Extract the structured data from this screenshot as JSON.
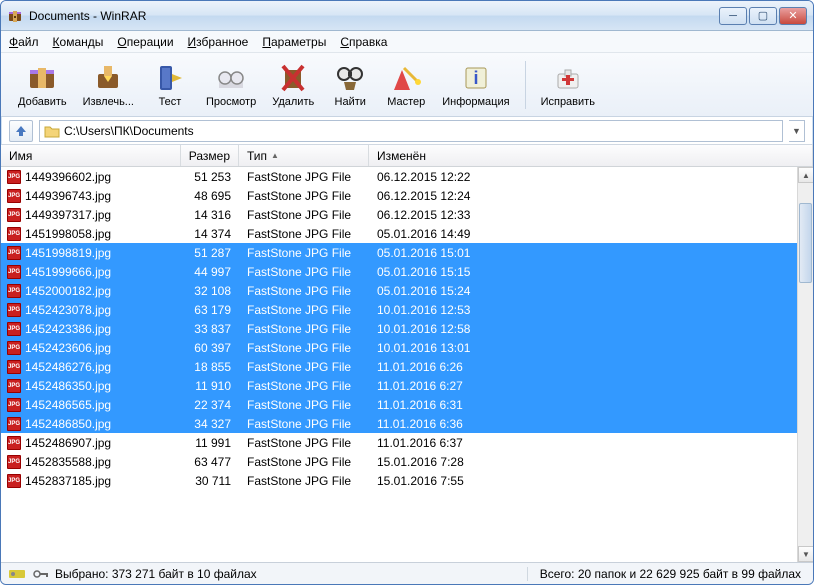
{
  "window": {
    "title": "Documents - WinRAR"
  },
  "menu": {
    "file": "Файл",
    "commands": "Команды",
    "operations": "Операции",
    "favorites": "Избранное",
    "options": "Параметры",
    "help": "Справка"
  },
  "toolbar": {
    "add": "Добавить",
    "extract": "Извлечь...",
    "test": "Тест",
    "view": "Просмотр",
    "delete": "Удалить",
    "find": "Найти",
    "wizard": "Мастер",
    "info": "Информация",
    "repair": "Исправить"
  },
  "path": "C:\\Users\\ПК\\Documents",
  "columns": {
    "name": "Имя",
    "size": "Размер",
    "type": "Тип",
    "modified": "Изменён"
  },
  "files": [
    {
      "name": "1449396602.jpg",
      "size": "51 253",
      "type": "FastStone JPG File",
      "mod": "06.12.2015 12:22",
      "sel": false
    },
    {
      "name": "1449396743.jpg",
      "size": "48 695",
      "type": "FastStone JPG File",
      "mod": "06.12.2015 12:24",
      "sel": false
    },
    {
      "name": "1449397317.jpg",
      "size": "14 316",
      "type": "FastStone JPG File",
      "mod": "06.12.2015 12:33",
      "sel": false
    },
    {
      "name": "1451998058.jpg",
      "size": "14 374",
      "type": "FastStone JPG File",
      "mod": "05.01.2016 14:49",
      "sel": false
    },
    {
      "name": "1451998819.jpg",
      "size": "51 287",
      "type": "FastStone JPG File",
      "mod": "05.01.2016 15:01",
      "sel": true
    },
    {
      "name": "1451999666.jpg",
      "size": "44 997",
      "type": "FastStone JPG File",
      "mod": "05.01.2016 15:15",
      "sel": true
    },
    {
      "name": "1452000182.jpg",
      "size": "32 108",
      "type": "FastStone JPG File",
      "mod": "05.01.2016 15:24",
      "sel": true
    },
    {
      "name": "1452423078.jpg",
      "size": "63 179",
      "type": "FastStone JPG File",
      "mod": "10.01.2016 12:53",
      "sel": true
    },
    {
      "name": "1452423386.jpg",
      "size": "33 837",
      "type": "FastStone JPG File",
      "mod": "10.01.2016 12:58",
      "sel": true
    },
    {
      "name": "1452423606.jpg",
      "size": "60 397",
      "type": "FastStone JPG File",
      "mod": "10.01.2016 13:01",
      "sel": true
    },
    {
      "name": "1452486276.jpg",
      "size": "18 855",
      "type": "FastStone JPG File",
      "mod": "11.01.2016 6:26",
      "sel": true
    },
    {
      "name": "1452486350.jpg",
      "size": "11 910",
      "type": "FastStone JPG File",
      "mod": "11.01.2016 6:27",
      "sel": true
    },
    {
      "name": "1452486565.jpg",
      "size": "22 374",
      "type": "FastStone JPG File",
      "mod": "11.01.2016 6:31",
      "sel": true
    },
    {
      "name": "1452486850.jpg",
      "size": "34 327",
      "type": "FastStone JPG File",
      "mod": "11.01.2016 6:36",
      "sel": true
    },
    {
      "name": "1452486907.jpg",
      "size": "11 991",
      "type": "FastStone JPG File",
      "mod": "11.01.2016 6:37",
      "sel": false
    },
    {
      "name": "1452835588.jpg",
      "size": "63 477",
      "type": "FastStone JPG File",
      "mod": "15.01.2016 7:28",
      "sel": false
    },
    {
      "name": "1452837185.jpg",
      "size": "30 711",
      "type": "FastStone JPG File",
      "mod": "15.01.2016 7:55",
      "sel": false
    }
  ],
  "status": {
    "selected": "Выбрано: 373 271 байт в 10 файлах",
    "total": "Всего: 20 папок и 22 629 925 байт в 99 файлах"
  }
}
